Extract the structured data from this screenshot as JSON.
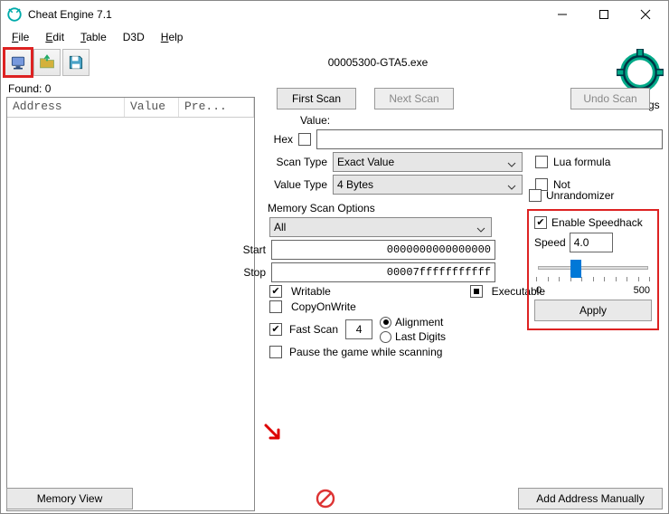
{
  "window": {
    "title": "Cheat Engine 7.1"
  },
  "menu": {
    "file": "File",
    "edit": "Edit",
    "table": "Table",
    "d3d": "D3D",
    "help": "Help"
  },
  "toolbar": {
    "process": "00005300-GTA5.exe"
  },
  "settings_label": "Settings",
  "left": {
    "found": "Found: 0",
    "headers": {
      "address": "Address",
      "value": "Value",
      "prev": "Pre..."
    }
  },
  "buttons": {
    "first_scan": "First Scan",
    "next_scan": "Next Scan",
    "undo_scan": "Undo Scan",
    "memory_view": "Memory View",
    "add_address": "Add Address Manually",
    "apply": "Apply"
  },
  "labels": {
    "value": "Value:",
    "hex": "Hex",
    "scan_type": "Scan Type",
    "value_type": "Value Type",
    "lua_formula": "Lua formula",
    "not": "Not",
    "mem_opts": "Memory Scan Options",
    "start": "Start",
    "stop": "Stop",
    "writable": "Writable",
    "executable": "Executable",
    "copyonwrite": "CopyOnWrite",
    "fast_scan": "Fast Scan",
    "alignment": "Alignment",
    "last_digits": "Last Digits",
    "pause": "Pause the game while scanning",
    "unrandomizer": "Unrandomizer",
    "enable_speedhack": "Enable Speedhack",
    "speed": "Speed",
    "slider_min": "0",
    "slider_max": "500"
  },
  "values": {
    "value_input": "",
    "scan_type": "Exact Value",
    "value_type": "4 Bytes",
    "mem_region": "All",
    "start": "0000000000000000",
    "stop": "00007fffffffffff",
    "fast_scan": "4",
    "speed": "4.0"
  }
}
